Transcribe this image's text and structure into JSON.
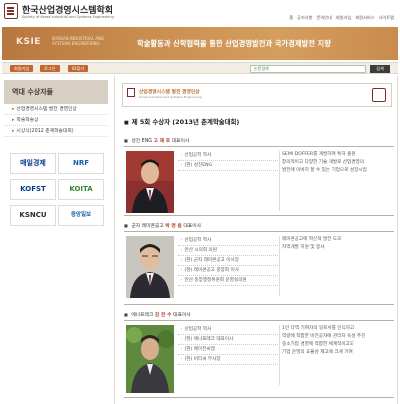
{
  "header": {
    "title": "한국산업경영시스템학회",
    "subtitle": "Society of Korea Industrial and Systems Engineering",
    "nav": [
      "홈",
      "공지사항",
      "문의안내",
      "회원가입",
      "회원서비스",
      "사이트맵"
    ]
  },
  "banner": {
    "logo_text": "KSIE",
    "english_lines": [
      "KOREAN INDUSTRIAL AND",
      "SYSTEMS ENGINEERING"
    ],
    "slogan": "학술활동과 산학협력을 통한 산업경영발전과 국가경제발전 지향"
  },
  "menubar": {
    "pills": [
      "회원가입",
      "로그인",
      "ID찾기"
    ],
    "search_placeholder": "논문검색",
    "search_button": "검색"
  },
  "sidebar": {
    "heading": "역대 수상자들",
    "items": [
      {
        "label": "산업경영시스템 발전 경영인상",
        "sub": false
      },
      {
        "label": "학술학술상",
        "sub": false
      },
      {
        "label": "시상식(2012 춘계학술대회)",
        "sub": false
      }
    ],
    "ads": [
      {
        "text": "매일경제",
        "color": "#0a3c8a"
      },
      {
        "text": "NRF",
        "color": "#1b5fa8"
      },
      {
        "text": "KOFST",
        "color": "#0a3c8a"
      },
      {
        "text": "KOITA",
        "color": "#2f8a3a"
      },
      {
        "text": "KSNCU",
        "color": "#2b2b2b"
      },
      {
        "text": "중앙일보",
        "color": "#1b5fa8"
      }
    ]
  },
  "content": {
    "box_title": "산업경영시스템 발전 경영인상",
    "box_subtitle": "Korea Industrial and Systems Engineering",
    "heading": "제 5회 수상자 (2013년 춘계학술대회)",
    "awardees": [
      {
        "company": "성진 ENG",
        "name": "고 재 호",
        "role": "대표이사",
        "info": [
          "산업공학 학사",
          "(현) 성진ENG"
        ],
        "desc": [
          "SEMI DOFFER를 개발하여 특허 출원",
          "창의적이고 다양한 기술 개발로 산업경영의",
          "발전에 이바지 할 수 있는 기업으로 성장시킴"
        ],
        "photo_bg": "#8b2f2f",
        "photo_suit": "#1d1d24"
      },
      {
        "company": "군자 레미콘공고",
        "name": "박 명 용",
        "role": "대표이사",
        "info": [
          "산업공학 학사",
          "안산 시의회 의원",
          "(현) 군자 레미콘공고 이사장",
          "(현) 레미콘공고 중앙회 이사",
          "안산 중앙행정위원회 운영실의원"
        ],
        "desc": [
          "레미콘공고에 혁신적 발전 도모",
          "지역개발 지원 및 봉사"
        ],
        "photo_bg": "#c9c6bf",
        "photo_suit": "#2a2a30"
      },
      {
        "company": "에나프레크",
        "name": "김 찬 수",
        "role": "대표이사",
        "info": [
          "산업공학 학사",
          "(현) 에나프레크 대표이사",
          "(현) 에이전씨엠",
          "(현) 비티씨 부사장"
        ],
        "desc": [
          "1인 다역 기여자의 일로서를 인식하고",
          "역량에 적합한 비전공자에 관리자 육성 추진",
          "중소기업 경영에 적합한 체계적이고도",
          "기업 운영의 효율성 제고에 크게 기여"
        ],
        "photo_bg": "#5f8a3e",
        "photo_suit": "#3a3a3e"
      }
    ]
  },
  "colors": {
    "accent": "#c0662e",
    "banner": "#c98d4f",
    "maroon": "#7a2e2e"
  }
}
